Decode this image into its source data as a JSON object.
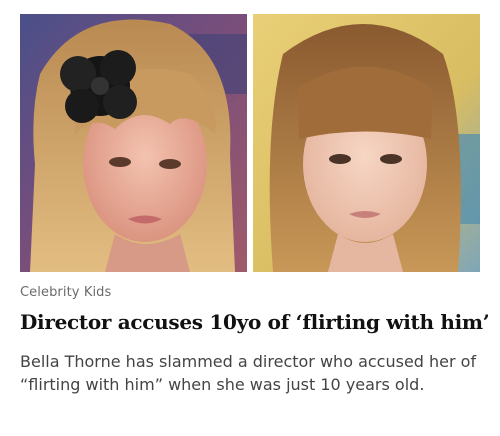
{
  "article": {
    "category": "Celebrity Kids",
    "headline": "Director accuses 10yo of ‘flirting with him’",
    "summary": "Bella Thorne has slammed a director who accused her of “flirting with him” when she was just 10 years old."
  },
  "images": [
    {
      "name": "photo-left",
      "icon": "girl-with-black-flower-hairclip-photo"
    },
    {
      "name": "photo-right",
      "icon": "girl-with-bangs-photo"
    }
  ],
  "colors": {
    "headline": "#111111",
    "summary": "#444444",
    "category": "#6b6b6b"
  }
}
